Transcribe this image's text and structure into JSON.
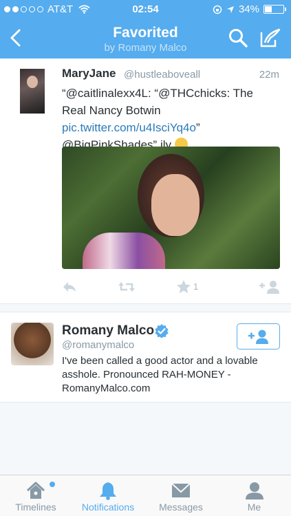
{
  "status_bar": {
    "carrier": "AT&T",
    "time": "02:54",
    "battery_percent": "34%",
    "battery_level": 0.34
  },
  "nav": {
    "title": "Favorited",
    "subtitle": "by Romany Malco"
  },
  "tweet": {
    "name": "MaryJane",
    "handle": "@hustleaboveall",
    "time": "22m",
    "text_part1": "“@caitlinalexx4L: “@THCchicks: The Real Nancy Botwin ",
    "link": "pic.twitter.com/u4IsciYq4o",
    "text_part2": "” @BigPinkShades” ily",
    "favorite_count": "1"
  },
  "profile": {
    "name": "Romany Malco",
    "handle": "@romanymalco",
    "bio": "I've been called a good actor and a lovable asshole. Pronounced RAH-MONEY - RomanyMalco.com"
  },
  "tabs": [
    {
      "label": "Timelines",
      "icon": "home-icon"
    },
    {
      "label": "Notifications",
      "icon": "bell-icon"
    },
    {
      "label": "Messages",
      "icon": "envelope-icon"
    },
    {
      "label": "Me",
      "icon": "person-icon"
    }
  ],
  "colors": {
    "brand": "#55acee",
    "link": "#2b7bb9",
    "muted": "#8899a6"
  }
}
